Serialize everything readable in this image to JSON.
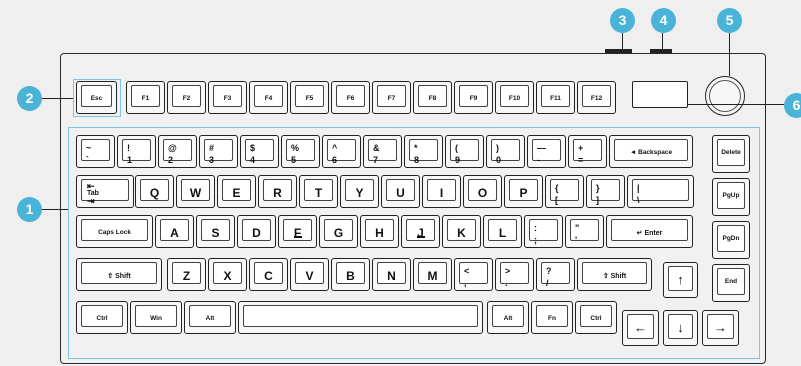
{
  "colors": {
    "accent": "#49b4d8",
    "zone": "#7cc7e4",
    "line": "#222222",
    "key_fill": "#ffffff"
  },
  "callouts": [
    "1",
    "2",
    "3",
    "4",
    "5",
    "6"
  ],
  "function_row": [
    "Esc",
    "F1",
    "F2",
    "F3",
    "F4",
    "F5",
    "F6",
    "F7",
    "F8",
    "F9",
    "F10",
    "F11",
    "F12"
  ],
  "number_row": [
    {
      "top": "~",
      "bottom": "`"
    },
    {
      "top": "!",
      "bottom": "1"
    },
    {
      "top": "@",
      "bottom": "2"
    },
    {
      "top": "#",
      "bottom": "3"
    },
    {
      "top": "$",
      "bottom": "4"
    },
    {
      "top": "%",
      "bottom": "5"
    },
    {
      "top": "^",
      "bottom": "6"
    },
    {
      "top": "&",
      "bottom": "7"
    },
    {
      "top": "*",
      "bottom": "8"
    },
    {
      "top": "(",
      "bottom": "9"
    },
    {
      "top": ")",
      "bottom": "0"
    },
    {
      "top": "—",
      "bottom": "-"
    },
    {
      "top": "+",
      "bottom": "="
    }
  ],
  "backspace": "◄ Backspace",
  "tab": {
    "top": "⇤",
    "mid": "Tab",
    "bottom": "⇥"
  },
  "qwerty_row": [
    "Q",
    "W",
    "E",
    "R",
    "T",
    "Y",
    "U",
    "I",
    "O",
    "P"
  ],
  "bracket_keys": [
    {
      "top": "{",
      "bottom": "["
    },
    {
      "top": "}",
      "bottom": "]"
    },
    {
      "top": "|",
      "bottom": "\\"
    }
  ],
  "caps_lock": "Caps Lock",
  "home_row": [
    "A",
    "S",
    "D",
    "F",
    "G",
    "H",
    "J",
    "K",
    "L"
  ],
  "semicolon_keys": [
    {
      "top": ":",
      "bottom": ";"
    },
    {
      "top": "\"",
      "bottom": "'"
    }
  ],
  "enter": "↵ Enter",
  "shift": "⇧ Shift",
  "bottom_letters": [
    "Z",
    "X",
    "C",
    "V",
    "B",
    "N",
    "M"
  ],
  "punct_keys": [
    {
      "top": "<",
      "bottom": ","
    },
    {
      "top": ">",
      "bottom": "."
    },
    {
      "top": "?",
      "bottom": "/"
    }
  ],
  "mod_row": {
    "ctrl": "Ctrl",
    "win": "Win",
    "alt": "Alt",
    "fn": "Fn"
  },
  "nav_column": [
    "Delete",
    "PgUp",
    "PgDn",
    "End"
  ],
  "arrows": {
    "up": "↑",
    "left": "←",
    "down": "↓",
    "right": "→"
  }
}
